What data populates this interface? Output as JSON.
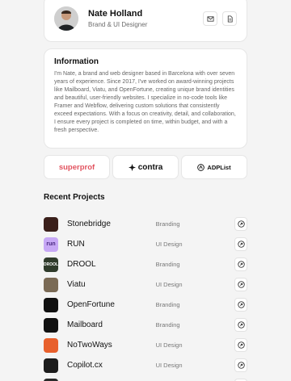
{
  "profile": {
    "name": "Nate Holland",
    "role": "Brand & UI Designer"
  },
  "information": {
    "title": "Information",
    "body": "I'm Nate, a brand and web designer based in Barcelona with over seven years of experience. Since 2017, I've worked on award-winning projects like Mailboard, Viatu, and OpenFortune, creating unique brand identities and beautiful, user-friendly websites. I specialize in no-code tools like Framer and Webflow, delivering custom solutions that consistently exceed expectations. With a focus on creativity, detail, and collaboration, I ensure every project is completed on time, within budget, and with a fresh perspective."
  },
  "brands": [
    {
      "label": "superprof",
      "color": "#e2535f"
    },
    {
      "label": "contra",
      "color": "#111111"
    },
    {
      "label": "ADPList",
      "color": "#111111"
    }
  ],
  "projects_title": "Recent Projects",
  "projects": [
    {
      "name": "Stonebridge",
      "category": "Branding",
      "thumb_color": "#3a1f1a",
      "thumb_text": ""
    },
    {
      "name": "RUN",
      "category": "UI Design",
      "thumb_color": "#c7a8f5",
      "thumb_text": "run"
    },
    {
      "name": "DROOL",
      "category": "Branding",
      "thumb_color": "#2f3b2b",
      "thumb_text": "DROOL"
    },
    {
      "name": "Viatu",
      "category": "UI Design",
      "thumb_color": "#7a6a55",
      "thumb_text": ""
    },
    {
      "name": "OpenFortune",
      "category": "Branding",
      "thumb_color": "#111111",
      "thumb_text": ""
    },
    {
      "name": "Mailboard",
      "category": "Branding",
      "thumb_color": "#111111",
      "thumb_text": ""
    },
    {
      "name": "NoTwoWays",
      "category": "UI Design",
      "thumb_color": "#e8602c",
      "thumb_text": ""
    },
    {
      "name": "Copilot.cx",
      "category": "UI Design",
      "thumb_color": "#1c1c1c",
      "thumb_text": ""
    },
    {
      "name": "",
      "category": "",
      "thumb_color": "#2a2a2a",
      "thumb_text": ""
    }
  ]
}
